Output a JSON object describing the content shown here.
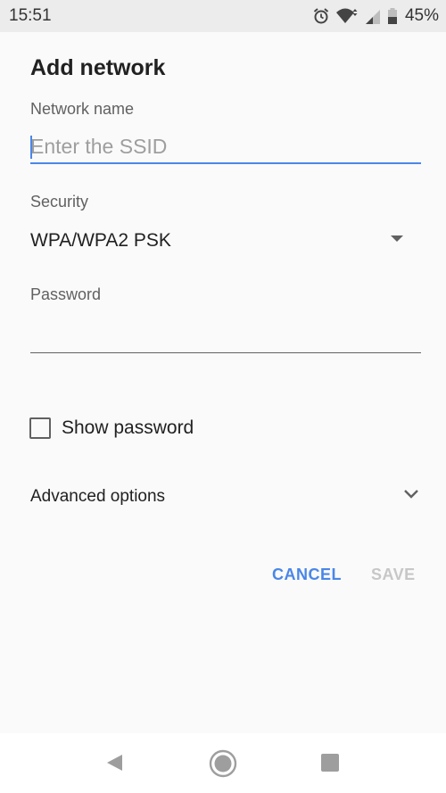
{
  "status_bar": {
    "time": "15:51",
    "battery_percent": "45%",
    "icons": [
      "alarm-icon",
      "wifi-icon",
      "cell-signal-icon",
      "battery-icon"
    ]
  },
  "dialog": {
    "title": "Add network",
    "network_name": {
      "label": "Network name",
      "placeholder": "Enter the SSID",
      "value": ""
    },
    "security": {
      "label": "Security",
      "selected": "WPA/WPA2 PSK"
    },
    "password": {
      "label": "Password",
      "value": ""
    },
    "show_password": {
      "label": "Show password",
      "checked": false
    },
    "advanced_options": {
      "label": "Advanced options"
    },
    "buttons": {
      "cancel": "CANCEL",
      "save": "SAVE"
    }
  },
  "nav_bar": {
    "icons": [
      "back-icon",
      "home-icon",
      "recents-icon"
    ]
  },
  "colors": {
    "accent": "#4a86e8",
    "disabled": "#c7c7c7",
    "background": "#fafafa",
    "status_bar": "#ececec"
  }
}
